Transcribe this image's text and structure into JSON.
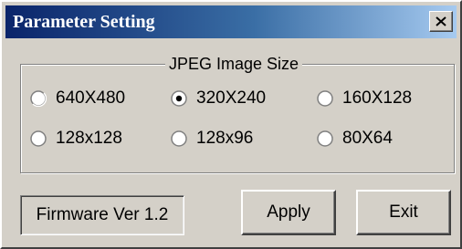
{
  "window": {
    "title": "Parameter Setting",
    "close_icon": "close-x-icon"
  },
  "group": {
    "label": "JPEG Image Size",
    "options": [
      {
        "label": "640X480",
        "selected": false
      },
      {
        "label": "320X240",
        "selected": true
      },
      {
        "label": "160X128",
        "selected": false
      },
      {
        "label": "128x128",
        "selected": false
      },
      {
        "label": "128x96",
        "selected": false
      },
      {
        "label": "80X64",
        "selected": false
      }
    ]
  },
  "footer": {
    "firmware_label": "Firmware Ver 1.2",
    "apply_label": "Apply",
    "exit_label": "Exit"
  },
  "colors": {
    "titlebar_start": "#0a246a",
    "titlebar_end": "#a6caf0",
    "face": "#d4d0c8"
  }
}
